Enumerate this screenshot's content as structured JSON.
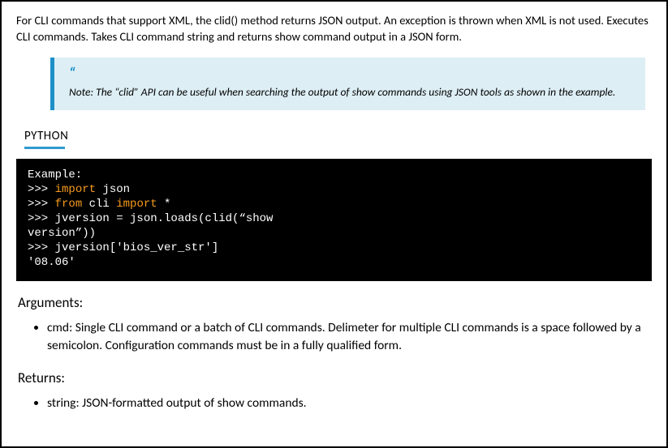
{
  "intro": "For CLI commands that support XML, the clid() method returns JSON output. An exception is thrown when XML  is not used. Executes CLI commands. Takes CLI command string and returns show command output in a JSON form.",
  "note": {
    "quote_mark": "“",
    "text": "Note: The “clid” API can be useful when searching the output of show  commands using JSON tools as shown in the example."
  },
  "lang_label": "PYTHON",
  "code": {
    "l1": "Example:",
    "l2a": ">>> ",
    "l2b": "import",
    "l2c": " json",
    "l3a": ">>> ",
    "l3b": "from",
    "l3c": " cli ",
    "l3d": "import",
    "l3e": " *",
    "l4": ">>> jversion = json.loads(clid(“show",
    "l5": "version”))",
    "l6": ">>> jversion['bios_ver_str']",
    "l7": "'08.06'"
  },
  "arguments": {
    "heading": "Arguments:",
    "item": "cmd: Single CLI command or a batch of CLI commands. Delimeter for multiple CLI commands is a space followed by a semicolon. Configuration commands must be in a fully qualified form."
  },
  "returns": {
    "heading": "Returns:",
    "item": "string: JSON-formatted output of show commands."
  }
}
